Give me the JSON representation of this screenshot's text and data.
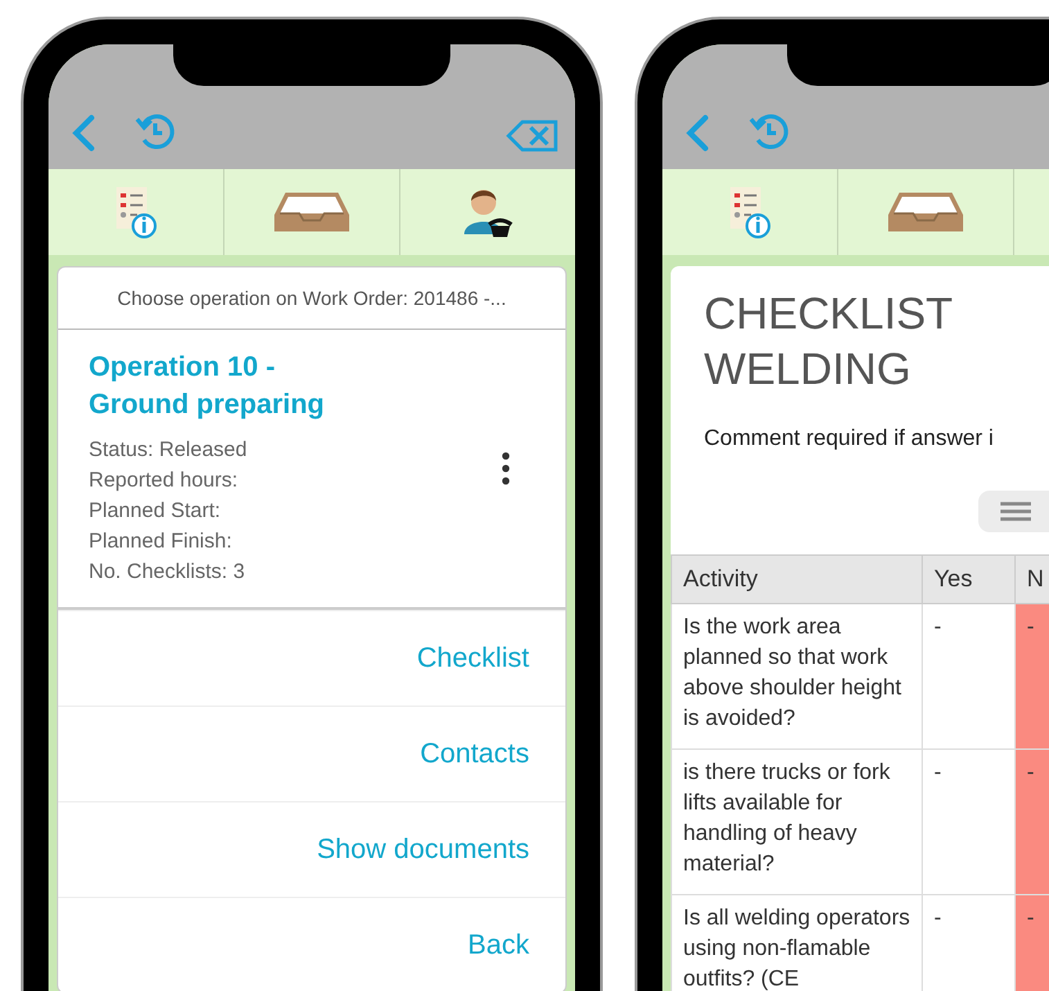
{
  "operation_screen": {
    "header": "Choose operation on Work Order: 201486 -...",
    "operation": {
      "title": "Operation 10 - Ground preparing",
      "details": [
        "Status: Released",
        "Reported hours:",
        "Planned Start:",
        "Planned Finish:",
        "No. Checklists: 3"
      ]
    },
    "actions": [
      "Checklist",
      "Contacts",
      "Show documents",
      "Back"
    ]
  },
  "checklist_screen": {
    "title": "CHECKLIST WELDING",
    "note": "Comment required if answer i",
    "table": {
      "columns": [
        "Activity",
        "Yes",
        "N"
      ],
      "rows": [
        {
          "activity": "Is the work area planned so that work above shoulder height is avoided?",
          "yes": "-",
          "no": "-",
          "flagged": true
        },
        {
          "activity": "is there trucks or fork lifts available for handling of heavy material?",
          "yes": "-",
          "no": "-",
          "flagged": true
        },
        {
          "activity": "Is all welding operators using non-flamable outfits? (CE",
          "yes": "-",
          "no": "-",
          "flagged": true
        }
      ]
    }
  }
}
